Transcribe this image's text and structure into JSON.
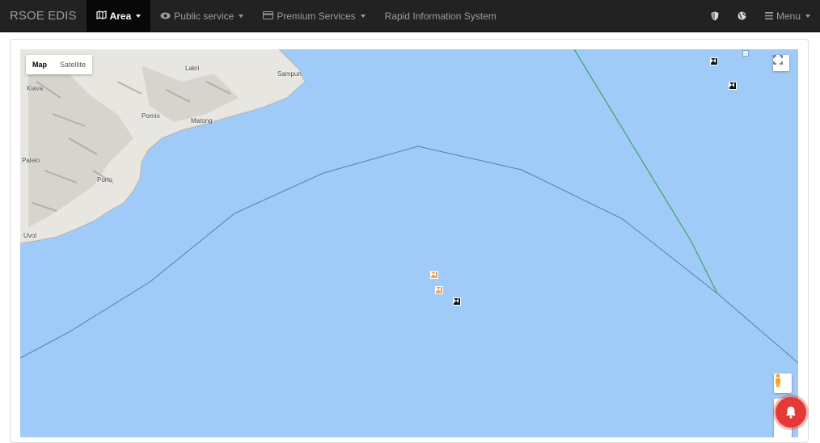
{
  "navbar": {
    "brand": "RSOE EDIS",
    "items": [
      {
        "label": "Area",
        "icon": "map-icon",
        "active": true
      },
      {
        "label": "Public service",
        "icon": "eye-icon"
      },
      {
        "label": "Premium Services",
        "icon": "card-icon"
      },
      {
        "label": "Rapid Information System"
      }
    ],
    "right": {
      "shield_icon": "shield-icon",
      "globe_icon": "globe-icon",
      "menu_label": "Menu"
    }
  },
  "map": {
    "type_control": {
      "map": "Map",
      "satellite": "Satellite",
      "selected": "Map"
    },
    "places": [
      "Lakri",
      "Sampun",
      "Kiava",
      "Pomio",
      "Matong",
      "Palelo",
      "Porlo",
      "Uvol"
    ],
    "colors": {
      "water": "#a0cbf8",
      "land": "#e8e6e1",
      "boundary": "#4f7fb8",
      "track": "#3aa55d"
    }
  },
  "notification": {
    "icon": "bell-icon",
    "color": "#e53935"
  }
}
